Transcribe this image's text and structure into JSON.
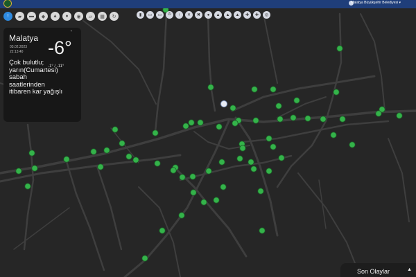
{
  "header": {
    "municipality": "Malatya Büyükşehir Belediyesi ▾",
    "logo_icon": "malatya-logo",
    "colors": {
      "bar": "#1f3e7a",
      "accent": "#2e8ae0"
    }
  },
  "left_toolbar": {
    "buttons": [
      {
        "icon": "traffic-light-icon",
        "active": true,
        "glyph": "!"
      },
      {
        "icon": "map-layer-icon",
        "glyph": "▰"
      },
      {
        "icon": "bus-icon",
        "glyph": "▬"
      },
      {
        "icon": "car-icon",
        "glyph": "◆"
      },
      {
        "icon": "accident-icon",
        "glyph": "▲"
      },
      {
        "icon": "warning-icon",
        "glyph": "●"
      },
      {
        "icon": "camera-icon",
        "glyph": "◉"
      },
      {
        "icon": "message-icon",
        "glyph": "▱"
      },
      {
        "icon": "grid-icon",
        "glyph": "▦"
      },
      {
        "icon": "refresh-icon",
        "glyph": "↻"
      }
    ]
  },
  "center_toolbar": {
    "buttons": [
      {
        "icon": "filter-icon",
        "glyph": "▮"
      },
      {
        "icon": "layers-icon",
        "glyph": "▭"
      },
      {
        "icon": "list-icon",
        "glyph": "▭"
      },
      {
        "icon": "power-icon",
        "glyph": "⏻"
      },
      {
        "icon": "pedestrian-icon",
        "glyph": "↑"
      },
      {
        "icon": "tools-icon",
        "glyph": "✕"
      },
      {
        "icon": "close-road-icon",
        "glyph": "✖"
      },
      {
        "icon": "no-entry-icon",
        "glyph": "●"
      },
      {
        "icon": "warning-triangle-icon",
        "glyph": "▲"
      },
      {
        "icon": "caution-icon",
        "glyph": "▲"
      },
      {
        "icon": "roadwork-icon",
        "glyph": "▲"
      },
      {
        "icon": "crossroad-icon",
        "glyph": "✚"
      },
      {
        "icon": "compass-icon",
        "glyph": "✚"
      },
      {
        "icon": "globe-icon",
        "glyph": "◎"
      }
    ]
  },
  "weather": {
    "city": "Malatya",
    "indicator": "-",
    "date": "03.02.2023",
    "time": "22:13:40",
    "temperature": "-6°",
    "hilo": "-1° / -11°",
    "description": "Çok bulutlu; yarın(Cumartesi) sabah saatlerinden itibaren kar yağışlı"
  },
  "events": {
    "label": "Son Olaylar",
    "chevron": "▲"
  },
  "map": {
    "colors": {
      "background": "#262626",
      "road": "#3e3e3e",
      "marker": "#34b34a"
    },
    "marker_count": 70
  }
}
